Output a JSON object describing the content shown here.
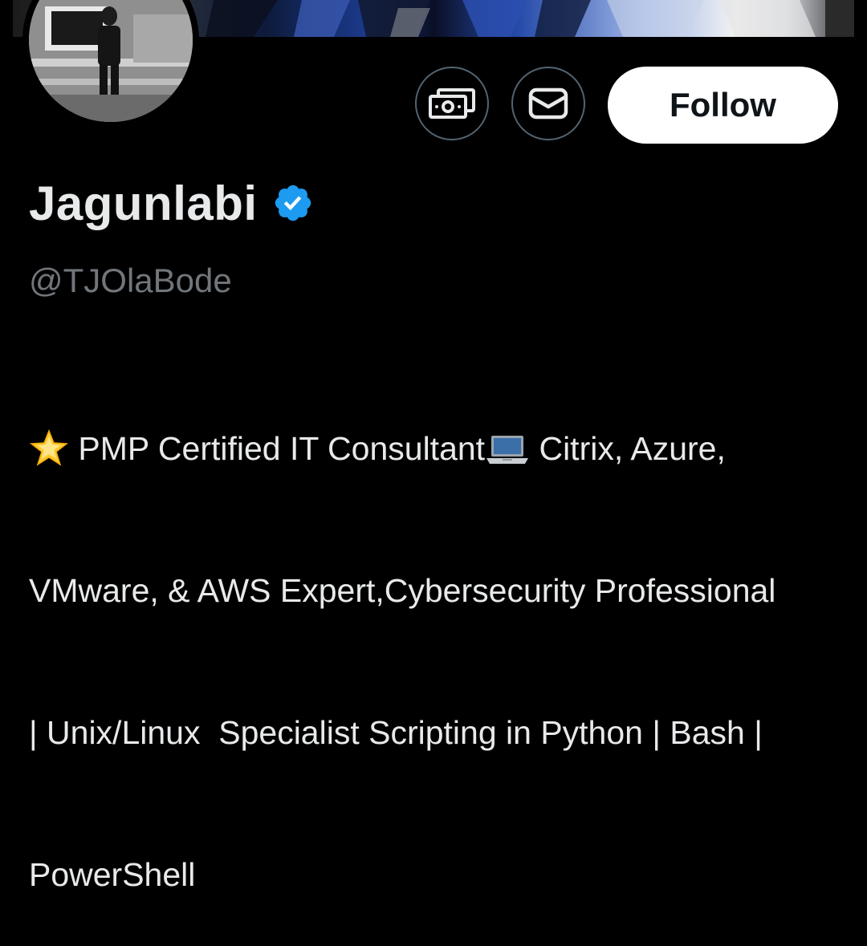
{
  "profile": {
    "display_name": "Jagunlabi",
    "handle": "@TJOlaBode",
    "verified_badge": "verified-badge-icon",
    "bio_lines": [
      "PMP Certified IT Consultant",
      "Citrix, Azure,",
      "VMware, & AWS Expert,Cybersecurity Professional",
      "| Unix/Linux  Specialist Scripting in Python | Bash |",
      "PowerShell"
    ]
  },
  "actions": {
    "tip_icon": "money-icon",
    "message_icon": "mail-icon",
    "follow_label": "Follow"
  },
  "icons": {
    "star_emoji": "star-emoji-icon",
    "laptop_emoji": "laptop-emoji-icon"
  },
  "colors": {
    "background": "#000000",
    "primary_text": "#e7e9ea",
    "secondary_text": "#71767b",
    "verified_blue": "#1d9bf0",
    "button_border": "#536471",
    "follow_bg": "#ffffff",
    "follow_text": "#0f1419"
  }
}
